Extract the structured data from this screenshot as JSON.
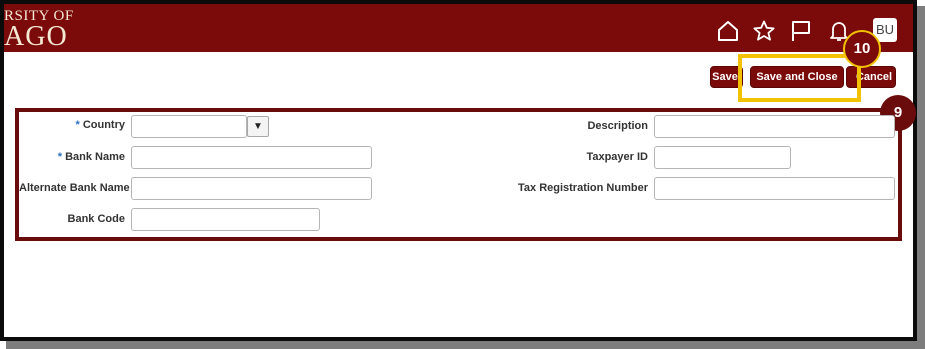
{
  "header": {
    "logo_line1": "RSITY OF",
    "logo_line2": "AGO",
    "avatar_initials": "BU"
  },
  "toolbar": {
    "save_label": "Save",
    "save_close_label": "Save and Close",
    "cancel_label": "Cancel"
  },
  "callouts": {
    "step_10": "10",
    "step_9": "9"
  },
  "form": {
    "country_label": "Country",
    "country_value": "",
    "bank_name_label": "Bank Name",
    "bank_name_value": "",
    "alt_bank_name_label": "Alternate Bank Name",
    "alt_bank_name_value": "",
    "bank_code_label": "Bank Code",
    "bank_code_value": "",
    "description_label": "Description",
    "description_value": "",
    "taxpayer_id_label": "Taxpayer ID",
    "taxpayer_id_value": "",
    "tax_reg_label": "Tax Registration Number",
    "tax_reg_value": "",
    "required_marker": "*"
  },
  "colors": {
    "brand": "#7b0a0a",
    "highlight": "#f2c200",
    "badge_10": "#7b0a0a",
    "badge_9": "#6a0c0c"
  }
}
